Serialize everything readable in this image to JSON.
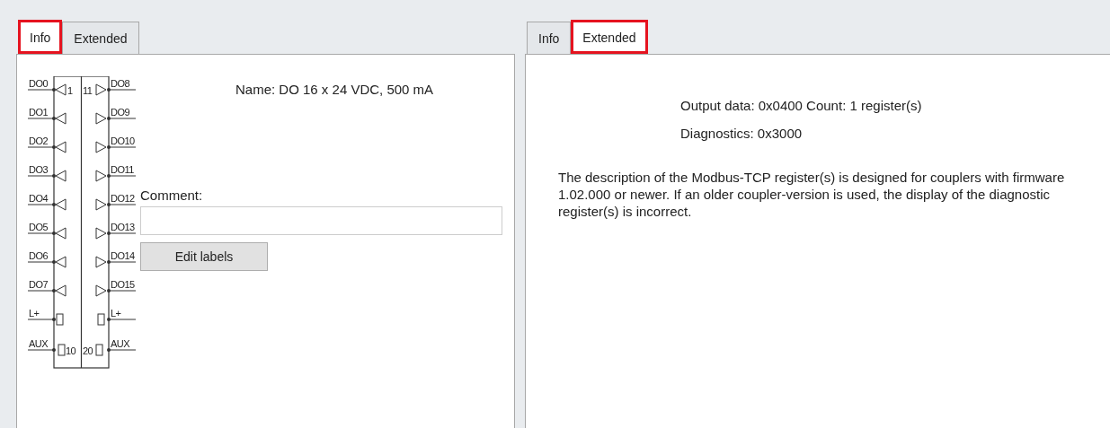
{
  "left_panel": {
    "tabs": [
      {
        "label": "Info",
        "selected": true
      },
      {
        "label": "Extended",
        "selected": false
      }
    ],
    "diagram": {
      "left_pins": [
        {
          "label": "DO0",
          "kind": "output",
          "number": "1"
        },
        {
          "label": "DO1",
          "kind": "output"
        },
        {
          "label": "DO2",
          "kind": "output"
        },
        {
          "label": "DO3",
          "kind": "output"
        },
        {
          "label": "DO4",
          "kind": "output"
        },
        {
          "label": "DO5",
          "kind": "output"
        },
        {
          "label": "DO6",
          "kind": "output"
        },
        {
          "label": "DO7",
          "kind": "output"
        },
        {
          "label": "L+",
          "kind": "supply"
        },
        {
          "label": "AUX",
          "kind": "supply",
          "number": "10"
        }
      ],
      "right_pins": [
        {
          "label": "DO8",
          "kind": "output",
          "number": "11"
        },
        {
          "label": "DO9",
          "kind": "output"
        },
        {
          "label": "DO10",
          "kind": "output"
        },
        {
          "label": "DO11",
          "kind": "output"
        },
        {
          "label": "DO12",
          "kind": "output"
        },
        {
          "label": "DO13",
          "kind": "output"
        },
        {
          "label": "DO14",
          "kind": "output"
        },
        {
          "label": "DO15",
          "kind": "output"
        },
        {
          "label": "L+",
          "kind": "supply"
        },
        {
          "label": "AUX",
          "kind": "supply",
          "number": "20"
        }
      ]
    },
    "name": "Name: DO 16 x 24 VDC, 500 mA",
    "comment_label": "Comment:",
    "edit_button": "Edit labels"
  },
  "right_panel": {
    "tabs": [
      {
        "label": "Info",
        "selected": false
      },
      {
        "label": "Extended",
        "selected": true
      }
    ],
    "output_data": "Output data: 0x0400 Count: 1 register(s)",
    "diagnostics": "Diagnostics: 0x3000",
    "description": "The description of the Modbus-TCP register(s) is designed for couplers with firmware 1.02.000 or newer. If an older coupler-version is used, the display of the diagnostic register(s) is incorrect."
  }
}
